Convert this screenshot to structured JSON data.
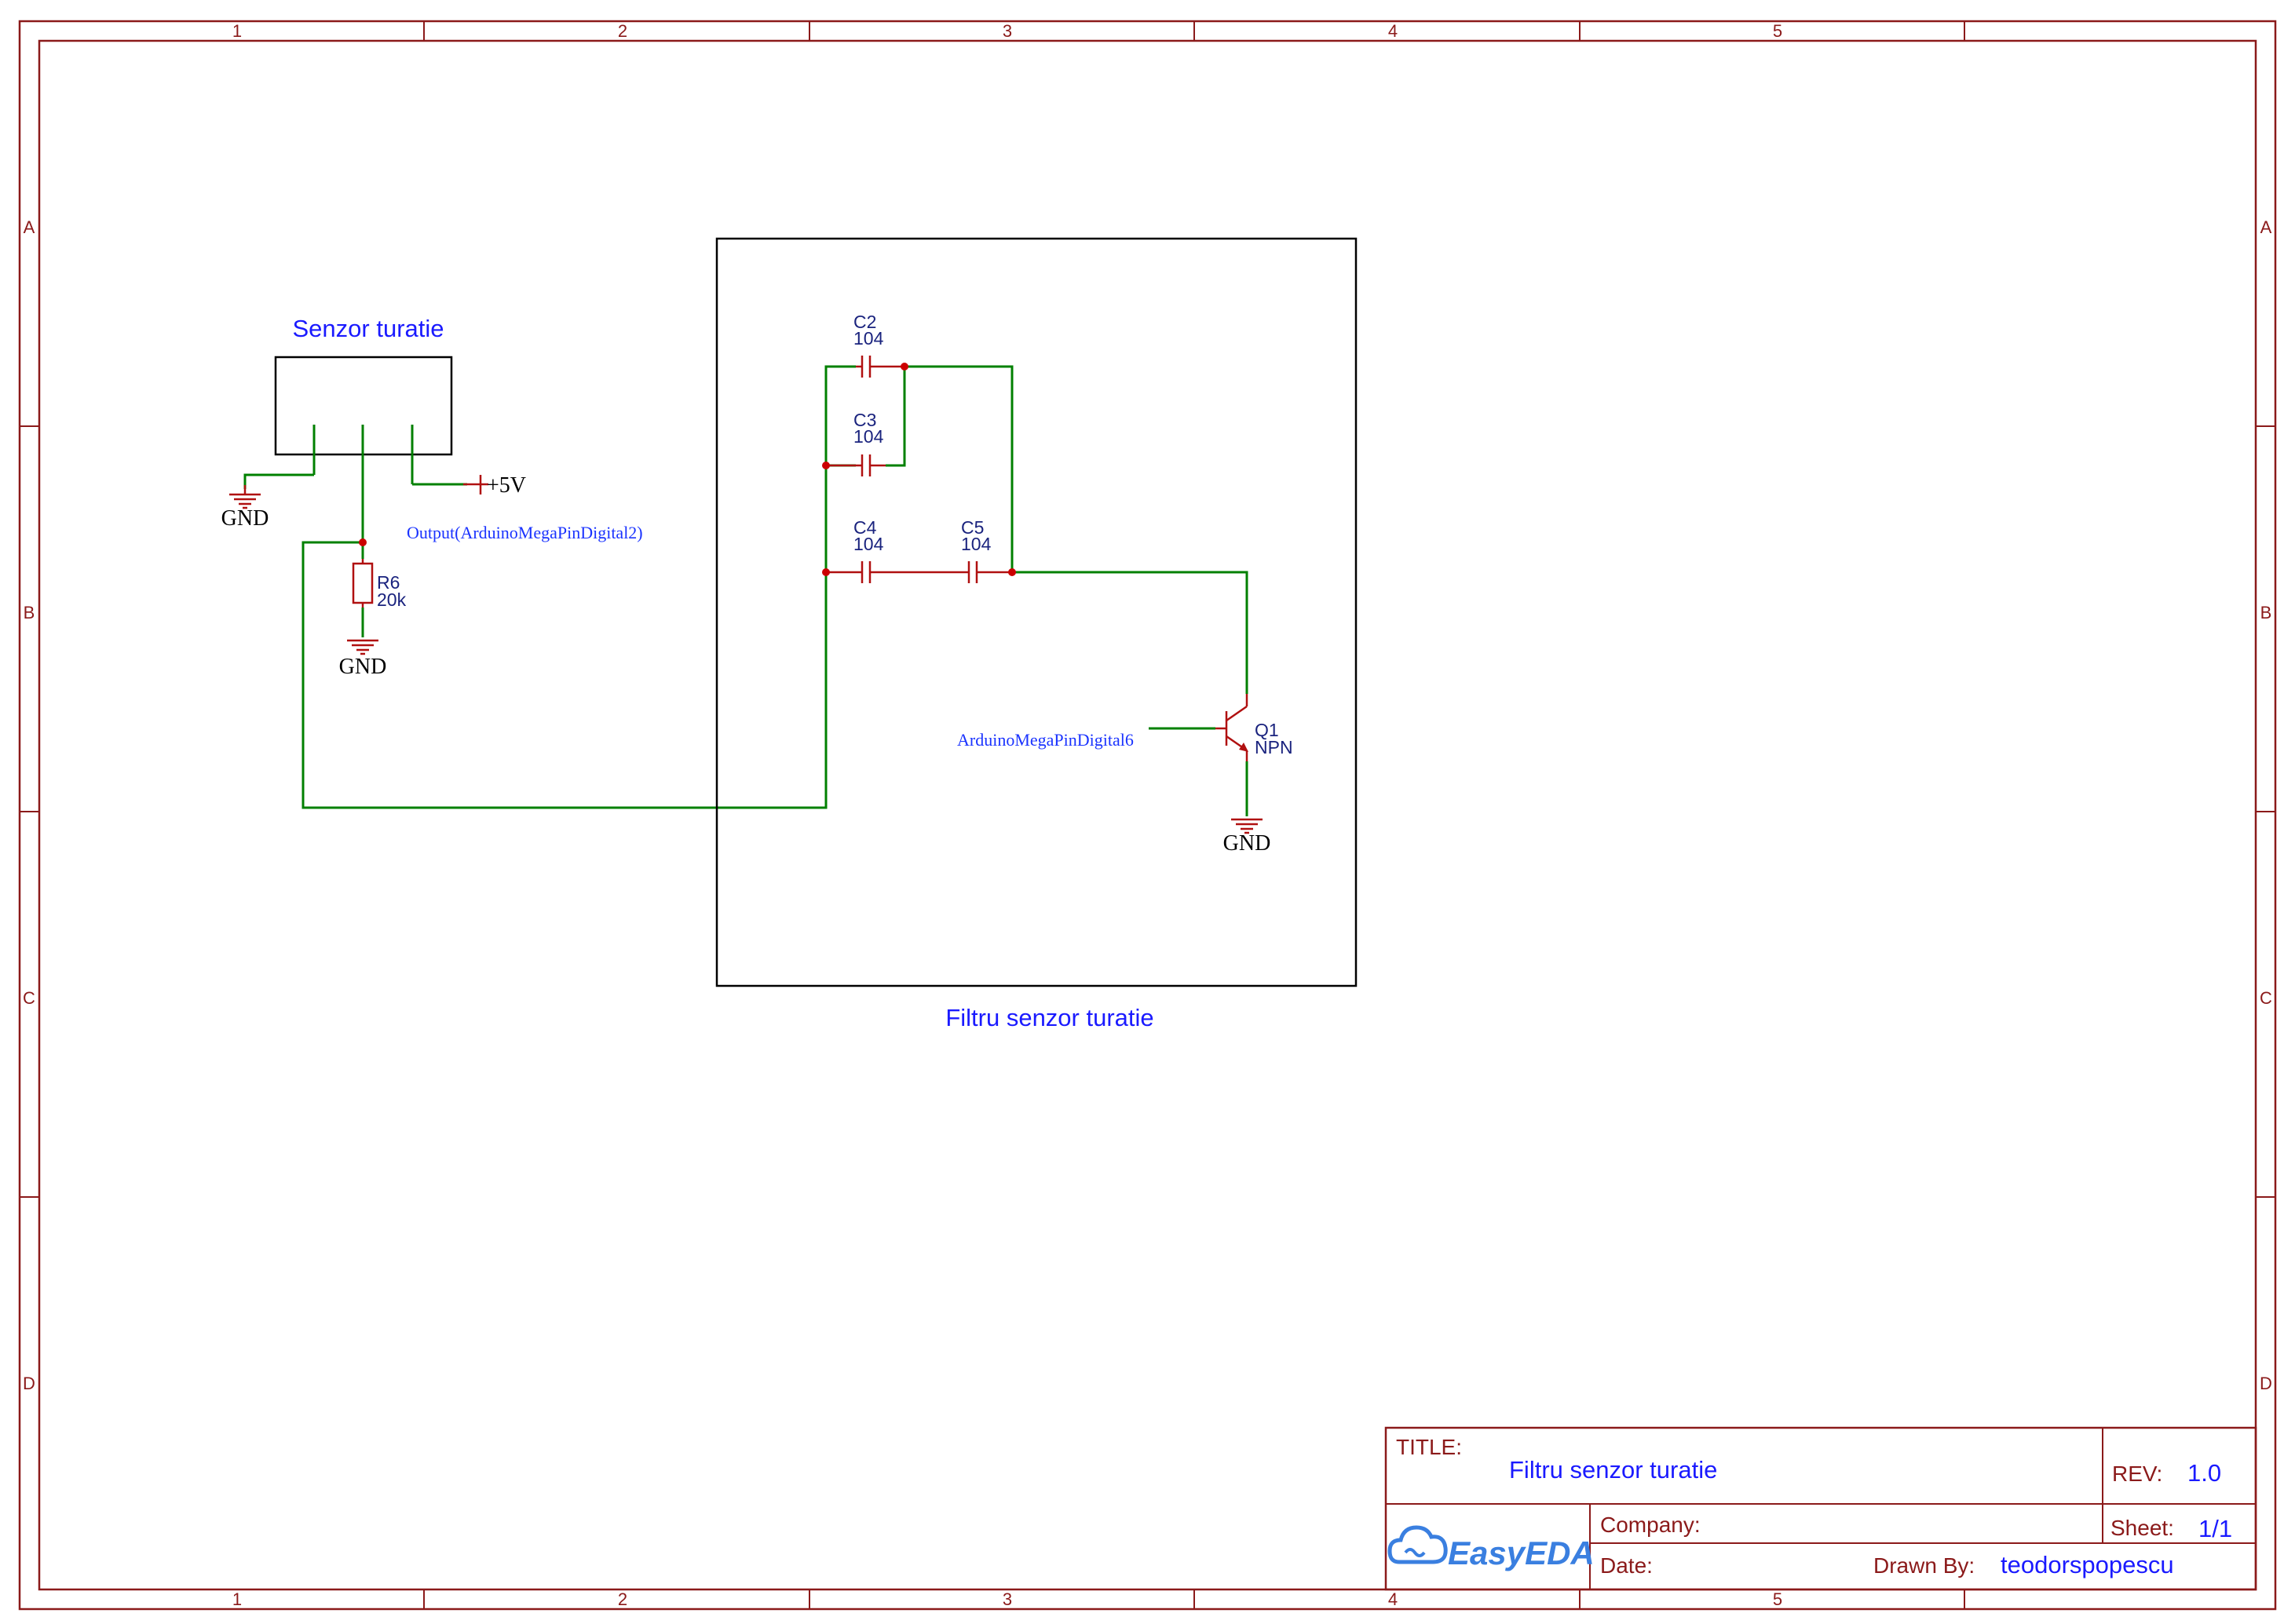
{
  "frame": {
    "columns": [
      "1",
      "2",
      "3",
      "4",
      "5"
    ],
    "rows": [
      "A",
      "B",
      "C",
      "D"
    ]
  },
  "blocks": {
    "sensor_title": "Senzor turatie",
    "filter_title": "Filtru senzor turatie"
  },
  "components": {
    "c2": {
      "ref": "C2",
      "value": "104"
    },
    "c3": {
      "ref": "C3",
      "value": "104"
    },
    "c4": {
      "ref": "C4",
      "value": "104"
    },
    "c5": {
      "ref": "C5",
      "value": "104"
    },
    "r6": {
      "ref": "R6",
      "value": "20k"
    },
    "q1": {
      "ref": "Q1",
      "value": "NPN"
    }
  },
  "nets": {
    "gnd": "GND",
    "vcc": "+5V",
    "output": "Output(ArduinoMegaPinDigital2)",
    "digital6": "ArduinoMegaPinDigital6"
  },
  "title_block": {
    "title_label": "TITLE:",
    "title_value": "Filtru senzor turatie",
    "rev_label": "REV:",
    "rev_value": "1.0",
    "company_label": "Company:",
    "company_value": "",
    "sheet_label": "Sheet:",
    "sheet_value": "1/1",
    "date_label": "Date:",
    "date_value": "",
    "drawn_label": "Drawn By:",
    "drawn_value": "teodorspopescu",
    "logo": "EasyEDA"
  },
  "colors": {
    "frame": "#8b1a1a",
    "wire": "#008000",
    "component": "#b01010",
    "junction": "#cc0000",
    "net_label": "#1a33ff",
    "title_text": "#1a1aff"
  }
}
